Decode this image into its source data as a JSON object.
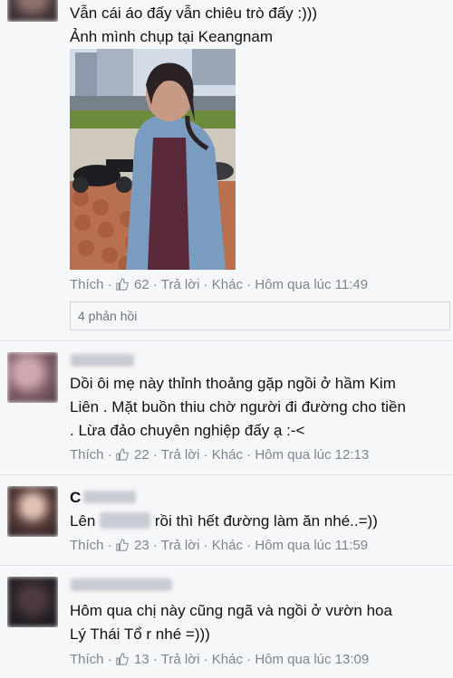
{
  "comments": [
    {
      "lines": [
        "Vẫn cái áo đấy vẫn chiêu trò đấy :)))",
        "Ảnh mình chụp tại Keangnam"
      ],
      "like": "Thích",
      "likes": "62",
      "reply": "Trả lời",
      "other": "Khác",
      "time": "Hôm qua lúc 11:49",
      "replies": "4 phản hồi"
    },
    {
      "lines": [
        "Dồi ôi mẹ này thỉnh thoảng gặp ngồi ở hầm Kim",
        "Liên . Mặt buồn thiu chờ người đi đường cho tiền",
        ". Lừa đảo chuyên nghiệp đấy ạ :-<"
      ],
      "like": "Thích",
      "likes": "22",
      "reply": "Trả lời",
      "other": "Khác",
      "time": "Hôm qua lúc 12:13"
    },
    {
      "name_initial": "C",
      "line_before": "Lên",
      "line_after": "rồi thì hết đường làm ăn nhé..=))",
      "like": "Thích",
      "likes": "23",
      "reply": "Trả lời",
      "other": "Khác",
      "time": "Hôm qua lúc 11:59"
    },
    {
      "lines": [
        "Hôm qua chị này cũng ngã và ngồi ở vườn hoa",
        "Lý Thái Tổ r nhé =)))"
      ],
      "like": "Thích",
      "likes": "13",
      "reply": "Trả lời",
      "other": "Khác",
      "time": "Hôm qua lúc 13:09"
    }
  ],
  "separator": "·",
  "icons": {
    "like": "thumbs-up-icon"
  },
  "colors": {
    "meta": "#7d8593",
    "text": "#111111",
    "background": "#f6f7f9"
  }
}
